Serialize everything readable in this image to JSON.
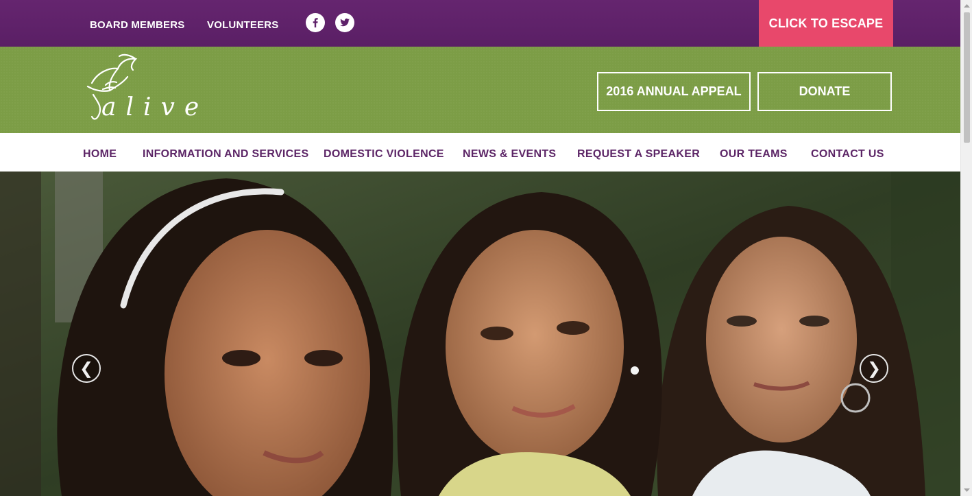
{
  "topbar": {
    "links": [
      "BOARD MEMBERS",
      "VOLUNTEERS"
    ],
    "escape_label": "CLICK TO ESCAPE",
    "social": [
      "facebook-icon",
      "twitter-icon"
    ],
    "colors": {
      "bar": "#5e2169",
      "escape": "#e8486b"
    }
  },
  "header": {
    "logo_text": "alive",
    "appeal_label": "2016 ANNUAL APPEAL",
    "donate_label": "DONATE",
    "colors": {
      "background": "#7c9d46"
    }
  },
  "nav": {
    "items": [
      "HOME",
      "INFORMATION AND SERVICES",
      "DOMESTIC VIOLENCE",
      "NEWS & EVENTS",
      "REQUEST A SPEAKER",
      "OUR TEAMS",
      "CONTACT US"
    ],
    "colors": {
      "text": "#5c2566"
    }
  },
  "hero": {
    "prev_icon": "chevron-left-icon",
    "next_icon": "chevron-right-icon",
    "prev_glyph": "❮",
    "next_glyph": "❯"
  }
}
